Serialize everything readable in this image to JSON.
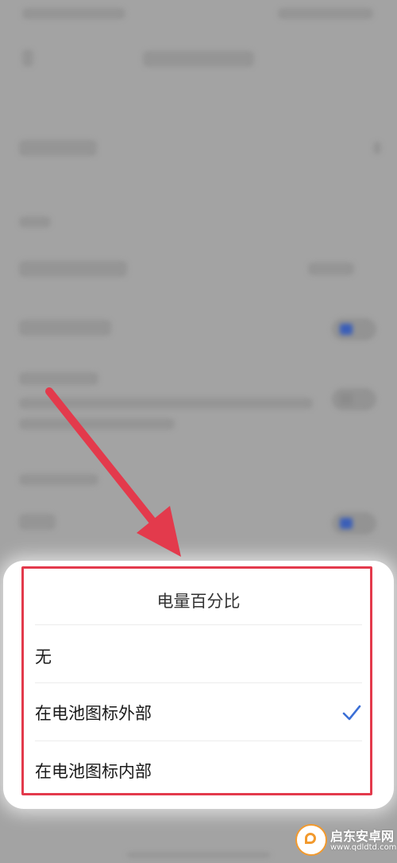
{
  "dialog": {
    "title": "电量百分比",
    "options": [
      {
        "label": "无",
        "selected": false
      },
      {
        "label": "在电池图标外部",
        "selected": true
      },
      {
        "label": "在电池图标内部",
        "selected": false
      }
    ]
  },
  "colors": {
    "accent": "#3b6fd6",
    "highlight": "#e33a4c",
    "overlay": "#a3a3a3"
  },
  "icons": {
    "selected": "check-icon",
    "annotation": "arrow-icon"
  },
  "watermark": {
    "name": "启东安卓网",
    "url": "www.qdldtd.com"
  }
}
